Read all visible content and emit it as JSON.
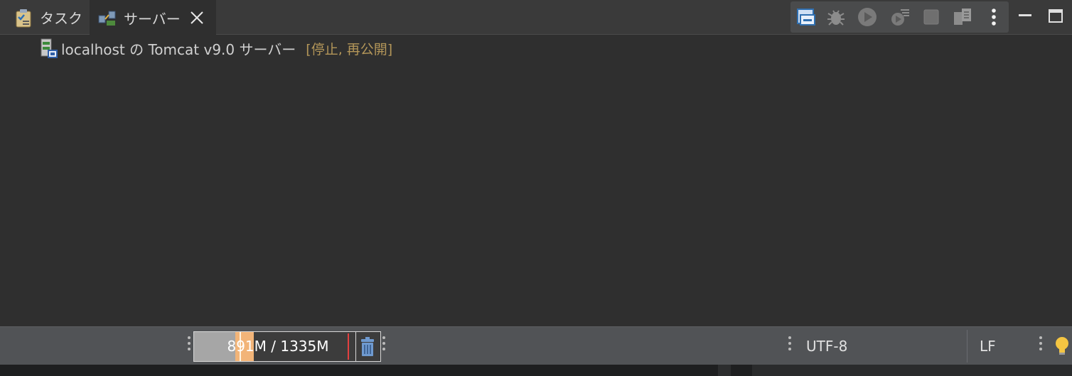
{
  "tabs": [
    {
      "label": "タスク",
      "icon": "tasks-icon",
      "active": false
    },
    {
      "label": "サーバー",
      "icon": "servers-icon",
      "active": true
    }
  ],
  "toolbar": {
    "buttons": [
      "collapse-all-icon",
      "debug-icon",
      "start-icon",
      "profile-icon",
      "stop-icon",
      "publish-icon",
      "more-icon"
    ]
  },
  "window": {
    "buttons": [
      "minimize-icon",
      "maximize-icon"
    ]
  },
  "server": {
    "name": "localhost の Tomcat v9.0 サーバー",
    "state": "[停止, 再公開]"
  },
  "status": {
    "heap_text": "891M / 1335M",
    "heap_used_fraction": 0.667,
    "encoding": "UTF-8",
    "line_delimiter": "LF"
  },
  "colors": {
    "background": "#2f2f2f",
    "tabbar": "#3a3a3a",
    "statusbar": "#515356",
    "state_text": "#b39659",
    "heap_marker": "#f2b478"
  }
}
